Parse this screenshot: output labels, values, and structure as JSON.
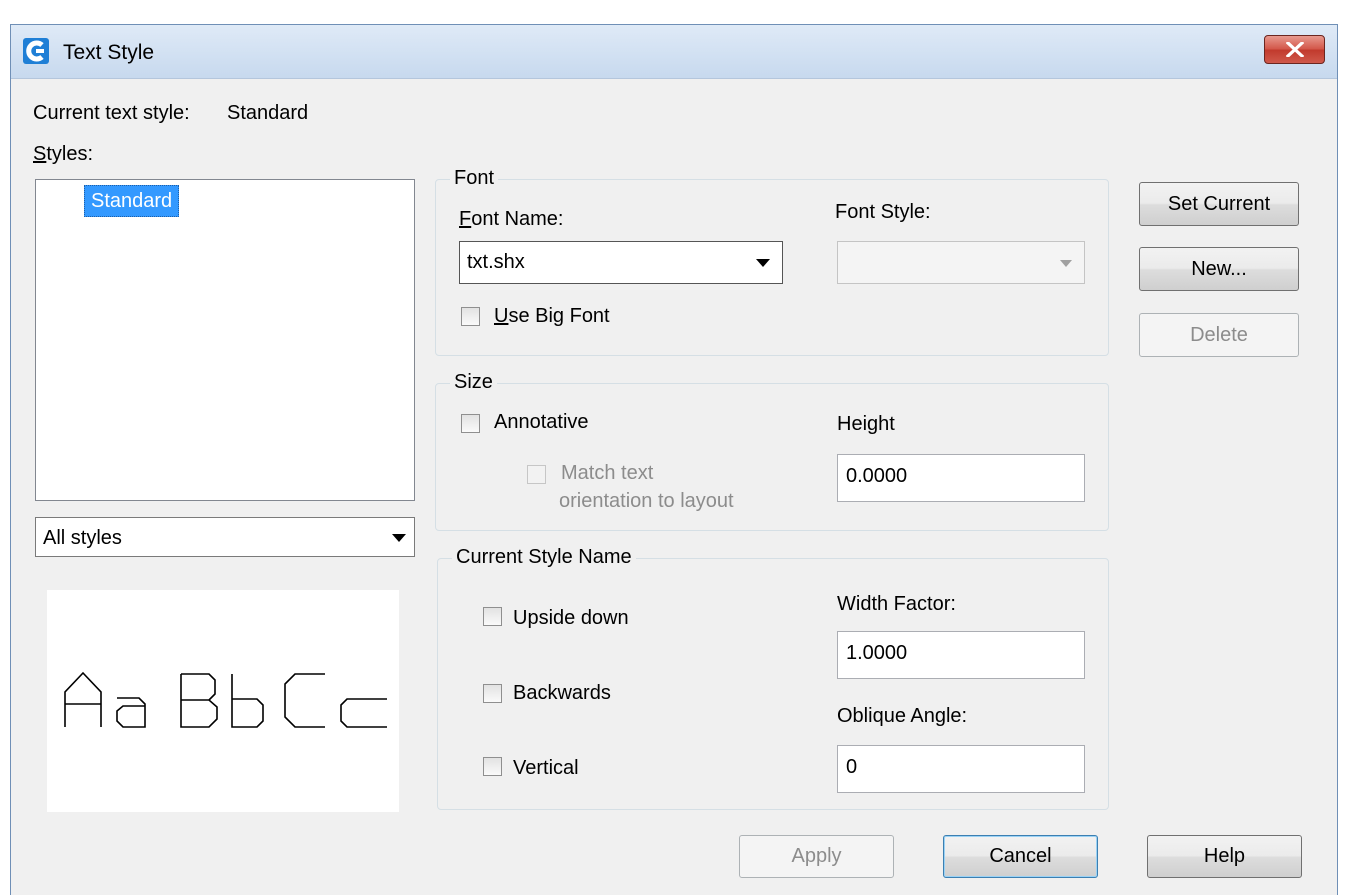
{
  "window": {
    "title": "Text Style",
    "icon": "app-logo-icon",
    "close_icon": "close-icon"
  },
  "current_style": {
    "label": "Current text style:",
    "value": "Standard"
  },
  "styles": {
    "label": "Styles:",
    "items": [
      "Standard"
    ],
    "filter": {
      "selected": "All styles"
    },
    "preview_text": "AaBbCc"
  },
  "font": {
    "group_title": "Font",
    "name_label": "Font Name:",
    "name_value": "txt.shx",
    "style_label": "Font Style:",
    "style_value": "",
    "big_font_label": "Use Big Font"
  },
  "size": {
    "group_title": "Size",
    "annotative_label": "Annotative",
    "match_line1": "Match text",
    "match_line2": "orientation to layout",
    "height_label": "Height",
    "height_value": "0.0000"
  },
  "effects": {
    "group_title": "Current Style Name",
    "upside_down_label": "Upside down",
    "backwards_label": "Backwards",
    "vertical_label": "Vertical",
    "width_factor_label": "Width Factor:",
    "width_factor_value": "1.0000",
    "oblique_label": "Oblique Angle:",
    "oblique_value": "0"
  },
  "buttons": {
    "set_current": "Set Current",
    "new": "New...",
    "delete": "Delete",
    "apply": "Apply",
    "cancel": "Cancel",
    "help": "Help"
  },
  "colors": {
    "selection": "#3399ff",
    "dialog_bg": "#f0f0f0",
    "close_red": "#c13a2d"
  }
}
